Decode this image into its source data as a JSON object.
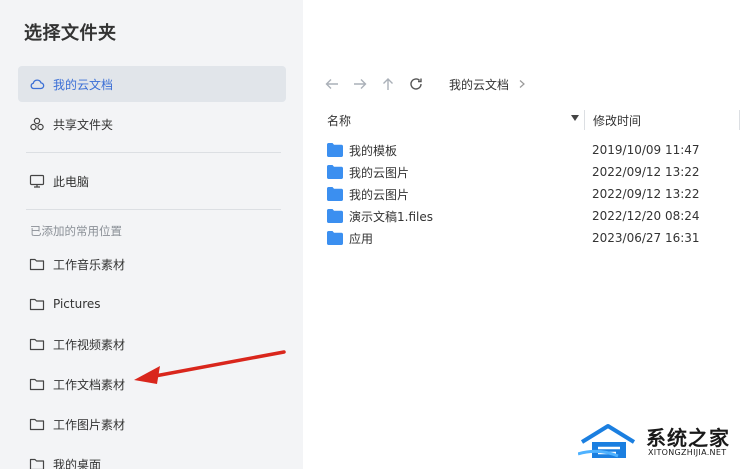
{
  "sidebar": {
    "title": "选择文件夹",
    "top_items": [
      {
        "label": "我的云文档",
        "icon": "cloud-icon",
        "active": true
      },
      {
        "label": "共享文件夹",
        "icon": "share-icon"
      }
    ],
    "computer": {
      "label": "此电脑",
      "icon": "monitor-icon"
    },
    "section_label": "已添加的常用位置",
    "locations": [
      {
        "label": "工作音乐素材",
        "icon": "folder-outline-icon"
      },
      {
        "label": "Pictures",
        "icon": "folder-outline-icon"
      },
      {
        "label": "工作视频素材",
        "icon": "folder-outline-icon"
      },
      {
        "label": "工作文档素材",
        "icon": "folder-outline-icon"
      },
      {
        "label": "工作图片素材",
        "icon": "folder-outline-icon"
      },
      {
        "label": "我的桌面",
        "icon": "folder-outline-icon"
      }
    ]
  },
  "toolbar": {
    "back_icon": "arrow-left-icon",
    "forward_icon": "arrow-right-icon",
    "up_icon": "arrow-up-icon",
    "refresh_icon": "refresh-icon",
    "breadcrumb": [
      "我的云文档"
    ]
  },
  "file_list": {
    "columns": {
      "name": "名称",
      "modified": "修改时间"
    },
    "rows": [
      {
        "name": "我的模板",
        "modified": "2019/10/09 11:47"
      },
      {
        "name": "我的云图片",
        "modified": "2022/09/12 13:22"
      },
      {
        "name": "我的云图片",
        "modified": "2022/09/12 13:22"
      },
      {
        "name": "演示文稿1.files",
        "modified": "2022/12/20 08:24"
      },
      {
        "name": "应用",
        "modified": "2023/06/27 16:31"
      }
    ]
  },
  "watermark": {
    "title": "系统之家",
    "subtitle": "XITONGZHIJIA.NET"
  },
  "colors": {
    "accent": "#3b6fd6",
    "folder": "#3b8ff0",
    "annotation_arrow": "#d9261c"
  }
}
